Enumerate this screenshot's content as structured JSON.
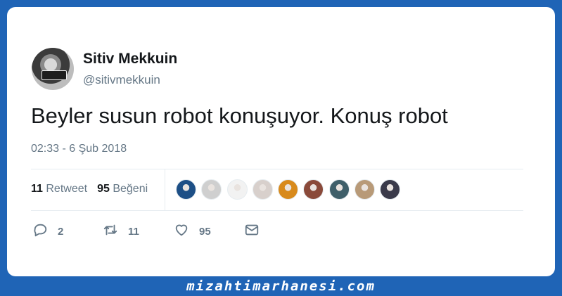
{
  "tweet": {
    "author_name": "Sitiv Mekkuin",
    "author_handle": "@sitivmekkuin",
    "text": "Beyler susun robot konuşuyor. Konuş robot",
    "timestamp": "02:33 - 6 Şub 2018"
  },
  "stats": {
    "retweet_count": "11",
    "retweet_label": "Retweet",
    "like_count": "95",
    "like_label": "Beğeni"
  },
  "likers": [
    {
      "color": "#1d4f86"
    },
    {
      "color": "#cfcfcf"
    },
    {
      "color": "#f2f2f2"
    },
    {
      "color": "#d8d0cc"
    },
    {
      "color": "#d88a1c"
    },
    {
      "color": "#8a4a3a"
    },
    {
      "color": "#3f5f6a"
    },
    {
      "color": "#b89a78"
    },
    {
      "color": "#3a3a4a"
    }
  ],
  "actions": {
    "reply_count": "2",
    "retweet_count": "11",
    "like_count": "95",
    "icons": [
      "reply-icon",
      "retweet-icon",
      "heart-icon",
      "message-icon"
    ]
  },
  "watermark": "mizahtimarhanesi.com",
  "colors": {
    "background": "#1f64b6",
    "text": "#14171a",
    "secondary_text": "#657786",
    "divider": "#e6ecf0"
  }
}
